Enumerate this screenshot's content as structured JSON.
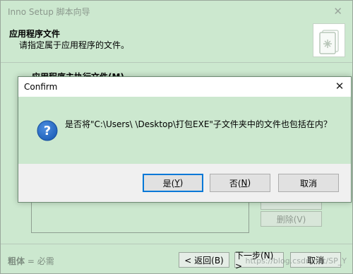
{
  "wizard": {
    "title": "Inno Setup 脚本向导",
    "close_glyph": "✕",
    "header_title": "应用程序文件",
    "header_subtitle": "请指定属于应用程序的文件。",
    "section_label": "应用程序主执行文件(M)",
    "delete_button": "删除(V)",
    "legend_bold": "粗体",
    "legend_rest": " = 必需",
    "back_button": "< 返回(B)",
    "next_button": "下一步(N) >",
    "cancel_button": "取消",
    "watermark": "https://blog.csdn.net/SP_Y"
  },
  "dialog": {
    "title": "Confirm",
    "close_glyph": "✕",
    "message": "是否将\"C:\\Users\\          \\Desktop\\打包EXE\"子文件夹中的文件也包括在内？",
    "yes_label": "是(",
    "yes_key": "Y",
    "no_label": "否(",
    "no_key": "N",
    "key_close": ")",
    "cancel_label": "取消",
    "icon": "question-icon"
  },
  "colors": {
    "background": "#cce8cf",
    "dialog_footer": "#f0f0f0",
    "icon_blue": "#1d5fb8",
    "default_button_border": "#0078d7"
  }
}
